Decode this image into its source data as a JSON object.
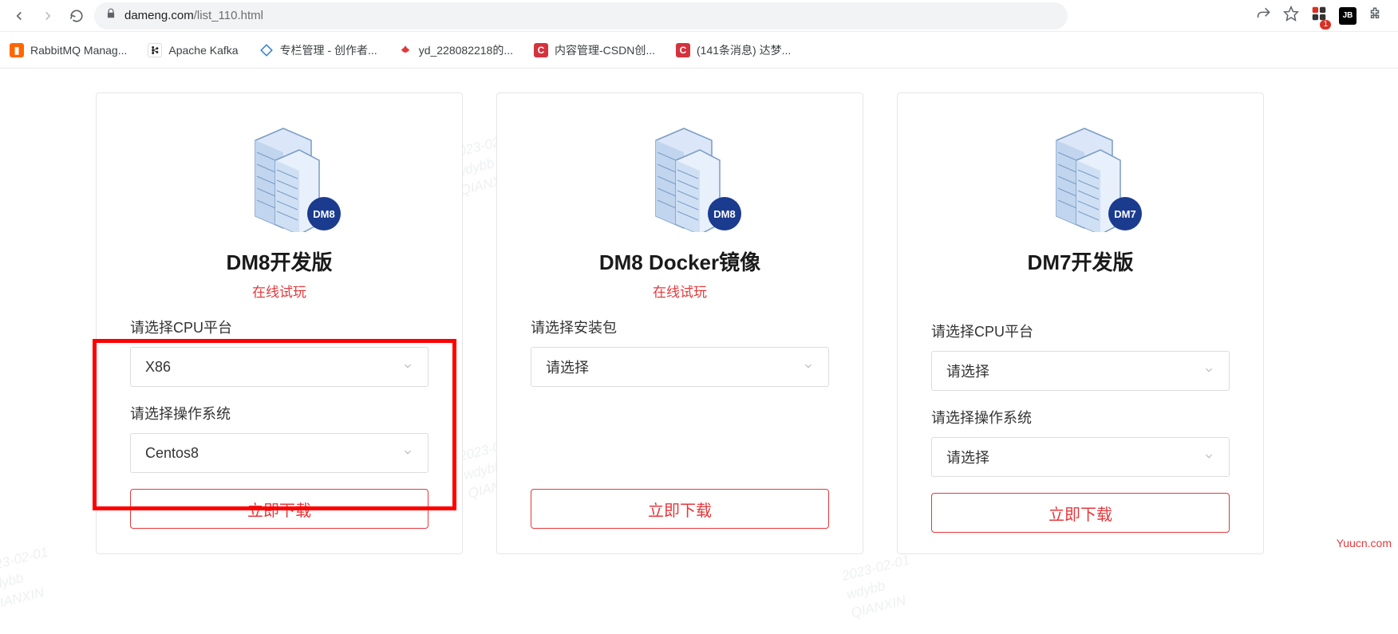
{
  "browser": {
    "url_domain": "dameng.com",
    "url_path": "/list_110.html",
    "ext_badge_count": "1",
    "jb_label": "JB"
  },
  "bookmarks": [
    {
      "label": "RabbitMQ Manag...",
      "color": "#ff6600"
    },
    {
      "label": "Apache Kafka",
      "color": "#888"
    },
    {
      "label": "专栏管理 - 创作者...",
      "color": "#2d7dd2"
    },
    {
      "label": "yd_228082218的...",
      "color": "#d4333e"
    },
    {
      "label": "内容管理-CSDN创...",
      "color": "#d4333e"
    },
    {
      "label": "(141条消息) 达梦...",
      "color": "#d4333e"
    }
  ],
  "cards": [
    {
      "badge": "DM8",
      "title": "DM8开发版",
      "subtitle": "在线试玩",
      "fields": [
        {
          "label": "请选择CPU平台",
          "value": "X86"
        },
        {
          "label": "请选择操作系统",
          "value": "Centos8"
        }
      ],
      "button": "立即下载"
    },
    {
      "badge": "DM8",
      "title": "DM8 Docker镜像",
      "subtitle": "在线试玩",
      "fields": [
        {
          "label": "请选择安装包",
          "value": "请选择"
        }
      ],
      "button": "立即下载"
    },
    {
      "badge": "DM7",
      "title": "DM7开发版",
      "subtitle": "",
      "fields": [
        {
          "label": "请选择CPU平台",
          "value": "请选择"
        },
        {
          "label": "请选择操作系统",
          "value": "请选择"
        }
      ],
      "button": "立即下载"
    }
  ],
  "watermark_text": "2023-02-01\nwdybb\nQIANXIN",
  "site_credit": "Yuucn.com"
}
